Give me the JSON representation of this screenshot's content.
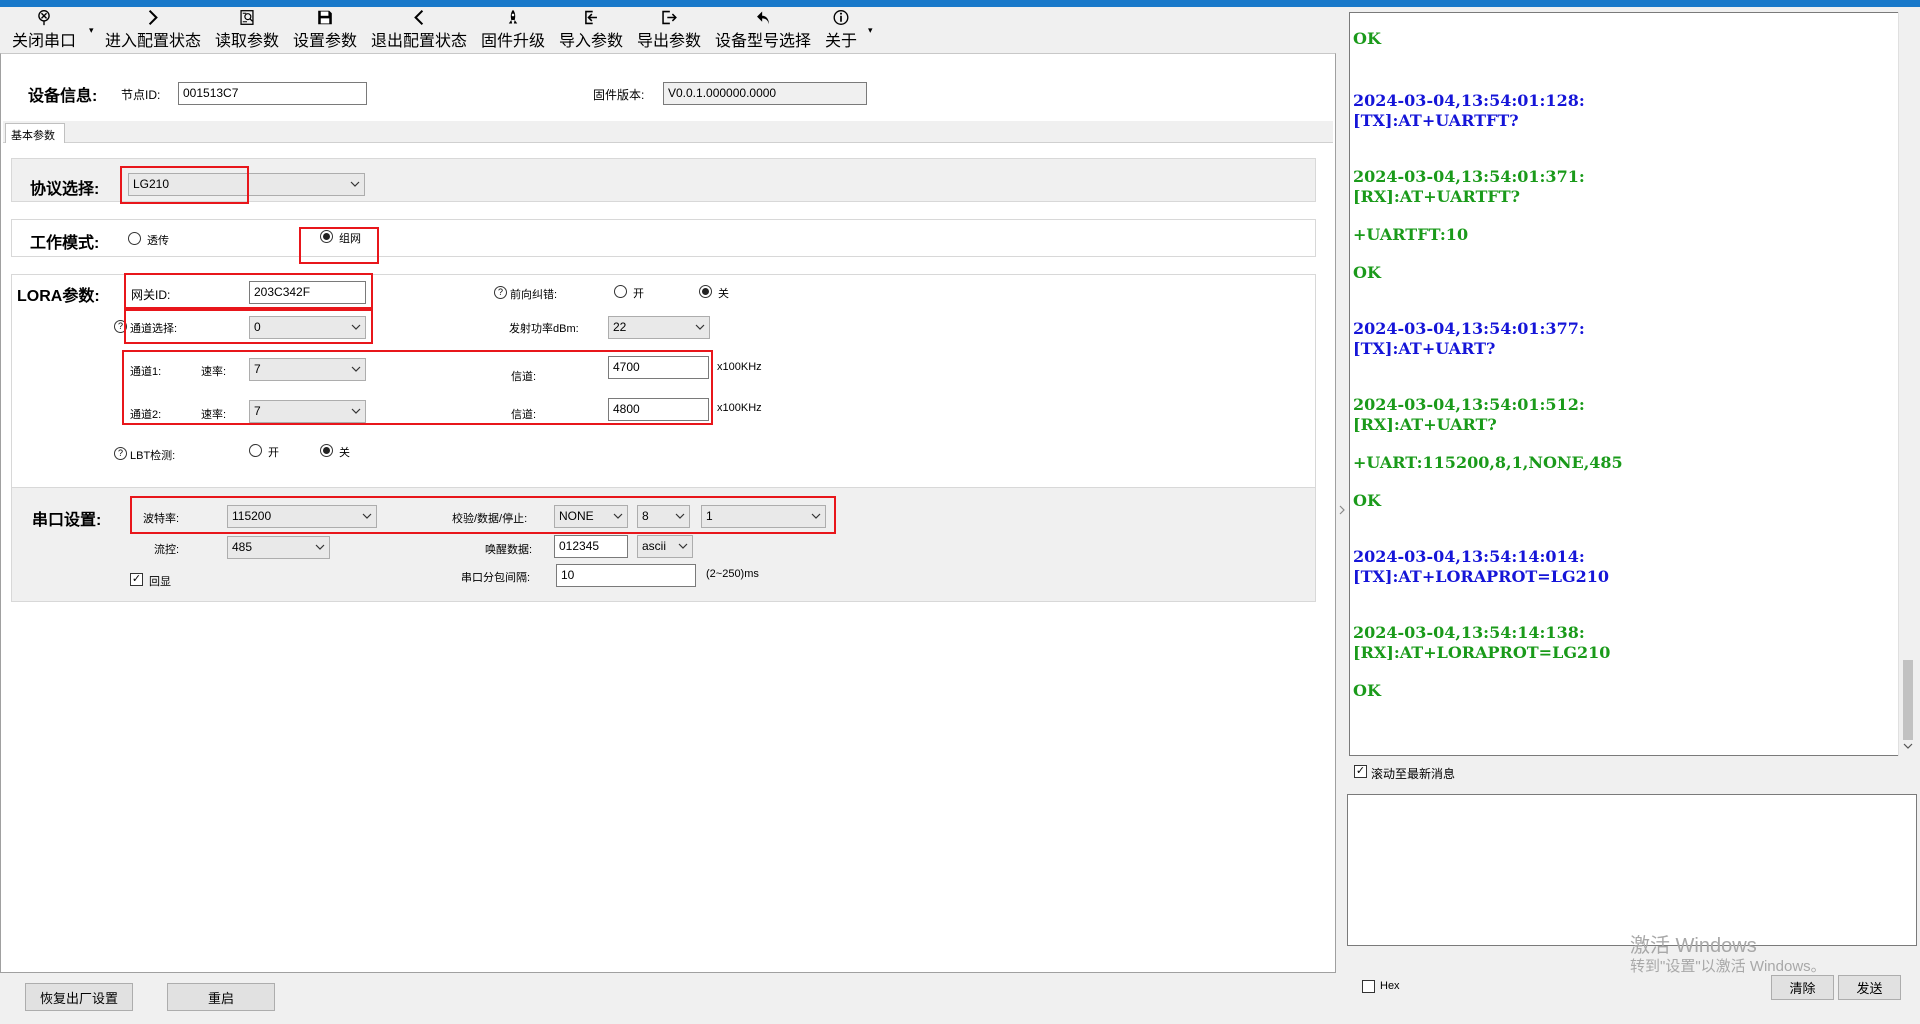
{
  "toolbar": {
    "close_port": "关闭串口",
    "enter_config": "进入配置状态",
    "read_params": "读取参数",
    "set_params": "设置参数",
    "exit_config": "退出配置状态",
    "firmware_upgrade": "固件升级",
    "import_params": "导入参数",
    "export_params": "导出参数",
    "device_model": "设备型号选择",
    "about": "关于"
  },
  "device_info": {
    "title": "设备信息:",
    "node_id_label": "节点ID:",
    "node_id": "001513C7",
    "firmware_label": "固件版本:",
    "firmware": "V0.0.1.000000.0000"
  },
  "tab": {
    "label": "基本参数"
  },
  "protocol": {
    "label": "协议选择:",
    "value": "LG210"
  },
  "work_mode": {
    "label": "工作模式:",
    "option_transparent": "透传",
    "option_network": "组网",
    "selected": "组网"
  },
  "lora": {
    "title": "LORA参数:",
    "gateway_id_label": "网关ID:",
    "gateway_id": "203C342F",
    "fec_label": "前向纠错:",
    "fec_on": "开",
    "fec_off": "关",
    "fec_selected": "关",
    "channel_select_label": "通道选择:",
    "channel_select": "0",
    "tx_power_label": "发射功率dBm:",
    "tx_power": "22",
    "ch1_label": "通道1:",
    "ch1_rate_label": "速率:",
    "ch1_rate": "7",
    "ch1_freq_label": "信道:",
    "ch1_freq": "4700",
    "ch1_unit": "x100KHz",
    "ch2_label": "通道2:",
    "ch2_rate_label": "速率:",
    "ch2_rate": "7",
    "ch2_freq_label": "信道:",
    "ch2_freq": "4800",
    "ch2_unit": "x100KHz",
    "lbt_label": "LBT检测:",
    "lbt_on": "开",
    "lbt_off": "关",
    "lbt_selected": "关"
  },
  "serial": {
    "title": "串口设置:",
    "baud_label": "波特率:",
    "baud": "115200",
    "parity_label": "校验/数据/停止:",
    "parity": "NONE",
    "databits": "8",
    "stopbits": "1",
    "flow_label": "流控:",
    "flow": "485",
    "wake_label": "唤醒数据:",
    "wake_data": "012345",
    "wake_format": "ascii",
    "echo_label": "回显",
    "echo_checked": true,
    "interval_label": "串口分包间隔:",
    "interval": "10",
    "interval_range": "(2~250)ms"
  },
  "bottom": {
    "factory_reset": "恢复出厂设置",
    "restart": "重启"
  },
  "log": {
    "lines": [
      {
        "text": "OK",
        "type": "rx"
      },
      {
        "text": "2024-03-04,13:54:01:128:",
        "type": "tx"
      },
      {
        "text": "[TX]:AT+UARTFT?",
        "type": "tx"
      },
      {
        "text": "2024-03-04,13:54:01:371:",
        "type": "rx"
      },
      {
        "text": "[RX]:AT+UARTFT?",
        "type": "rx"
      },
      {
        "text": "+UARTFT:10",
        "type": "rx"
      },
      {
        "text": "OK",
        "type": "rx"
      },
      {
        "text": "2024-03-04,13:54:01:377:",
        "type": "tx"
      },
      {
        "text": "[TX]:AT+UART?",
        "type": "tx"
      },
      {
        "text": "2024-03-04,13:54:01:512:",
        "type": "rx"
      },
      {
        "text": "[RX]:AT+UART?",
        "type": "rx"
      },
      {
        "text": "+UART:115200,8,1,NONE,485",
        "type": "rx"
      },
      {
        "text": "OK",
        "type": "rx"
      },
      {
        "text": "2024-03-04,13:54:14:014:",
        "type": "tx"
      },
      {
        "text": "[TX]:AT+LORAPROT=LG210",
        "type": "tx"
      },
      {
        "text": "2024-03-04,13:54:14:138:",
        "type": "rx"
      },
      {
        "text": "[RX]:AT+LORAPROT=LG210",
        "type": "rx"
      },
      {
        "text": "OK",
        "type": "rx"
      }
    ],
    "scroll_to_latest_label": "滚动至最新消息",
    "scroll_to_latest_checked": true,
    "hex_label": "Hex",
    "clear_label": "清除",
    "send_label": "发送"
  },
  "watermark": {
    "line1": "激活 Windows",
    "line2": "转到\"设置\"以激活 Windows。"
  },
  "colors": {
    "tx": "#1515d8",
    "rx": "#1a9a1a",
    "highlight": "#e8161b",
    "titlebar": "#1979ca"
  }
}
